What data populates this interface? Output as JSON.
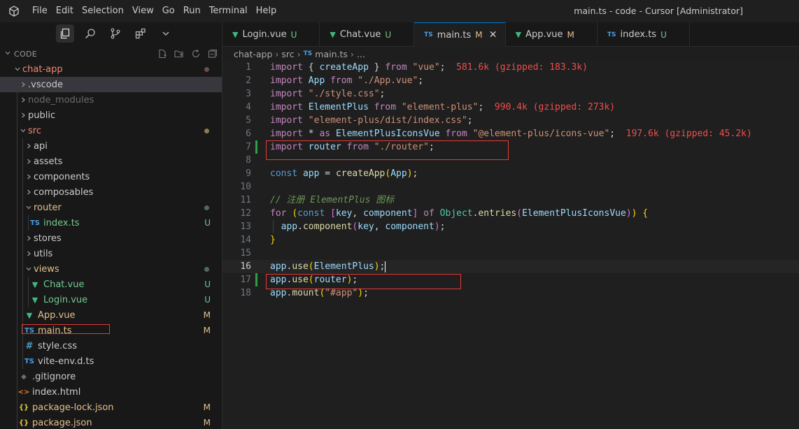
{
  "window": {
    "title": "main.ts - code - Cursor [Administrator]",
    "menu": [
      "File",
      "Edit",
      "Selection",
      "View",
      "Go",
      "Run",
      "Terminal",
      "Help"
    ]
  },
  "sidebar": {
    "explorer_title": "CODE",
    "tree": [
      {
        "label": "chat-app",
        "type": "folder",
        "open": true,
        "depth": 0,
        "color": "#f48771",
        "dot": "#6e4c4c"
      },
      {
        "label": ".vscode",
        "type": "folder",
        "open": false,
        "depth": 1,
        "selected": true
      },
      {
        "label": "node_modules",
        "type": "folder",
        "open": false,
        "depth": 1,
        "dim": true
      },
      {
        "label": "public",
        "type": "folder",
        "open": false,
        "depth": 1
      },
      {
        "label": "src",
        "type": "folder",
        "open": true,
        "depth": 1,
        "color": "#f48771",
        "dot": "#8b7b4e"
      },
      {
        "label": "api",
        "type": "folder",
        "open": false,
        "depth": 2
      },
      {
        "label": "assets",
        "type": "folder",
        "open": false,
        "depth": 2
      },
      {
        "label": "components",
        "type": "folder",
        "open": false,
        "depth": 2
      },
      {
        "label": "composables",
        "type": "folder",
        "open": false,
        "depth": 2
      },
      {
        "label": "router",
        "type": "folder",
        "open": true,
        "depth": 2,
        "color": "#e2c08d",
        "dot": "#4e6b5a"
      },
      {
        "label": "index.ts",
        "type": "ts",
        "depth": 3,
        "status": "U",
        "color": "#73c991"
      },
      {
        "label": "stores",
        "type": "folder",
        "open": false,
        "depth": 2
      },
      {
        "label": "utils",
        "type": "folder",
        "open": false,
        "depth": 2
      },
      {
        "label": "views",
        "type": "folder",
        "open": true,
        "depth": 2,
        "color": "#e2c08d",
        "dot": "#4e6b5a"
      },
      {
        "label": "Chat.vue",
        "type": "vue",
        "depth": 3,
        "status": "U",
        "color": "#73c991"
      },
      {
        "label": "Login.vue",
        "type": "vue",
        "depth": 3,
        "status": "U",
        "color": "#73c991"
      },
      {
        "label": "App.vue",
        "type": "vue",
        "depth": 2,
        "status": "M",
        "color": "#e2c08d"
      },
      {
        "label": "main.ts",
        "type": "ts",
        "depth": 2,
        "status": "M",
        "color": "#e2c08d",
        "boxed": true,
        "active": true
      },
      {
        "label": "style.css",
        "type": "css",
        "depth": 2
      },
      {
        "label": "vite-env.d.ts",
        "type": "ts",
        "depth": 2
      },
      {
        "label": ".gitignore",
        "type": "git",
        "depth": 1
      },
      {
        "label": "index.html",
        "type": "html",
        "depth": 1
      },
      {
        "label": "package-lock.json",
        "type": "json",
        "depth": 1,
        "status": "M",
        "color": "#e2c08d"
      },
      {
        "label": "package.json",
        "type": "json",
        "depth": 1,
        "status": "M",
        "color": "#e2c08d"
      }
    ]
  },
  "tabs": [
    {
      "label": "Login.vue",
      "icon": "vue",
      "status": "U",
      "active": false
    },
    {
      "label": "Chat.vue",
      "icon": "vue",
      "status": "U",
      "active": false
    },
    {
      "label": "main.ts",
      "icon": "ts",
      "status": "M",
      "active": true
    },
    {
      "label": "App.vue",
      "icon": "vue",
      "status": "M",
      "active": false
    },
    {
      "label": "index.ts",
      "icon": "ts",
      "status": "U",
      "active": false
    }
  ],
  "breadcrumbs": [
    "chat-app",
    "src",
    "main.ts",
    "..."
  ],
  "editor": {
    "current_line": 16,
    "lines": [
      {
        "n": 1,
        "html": "<span class='kc'>import</span> <span class='p'>{ </span><span class='v'>createApp</span><span class='p'> } </span><span class='kc'>from</span> <span class='s'>\"vue\"</span><span class='p'>;</span>  <span class='size'>581.6k (gzipped: 183.3k)</span>"
      },
      {
        "n": 2,
        "html": "<span class='kc'>import</span> <span class='v'>App</span> <span class='kc'>from</span> <span class='s'>\"./App.vue\"</span><span class='p'>;</span>"
      },
      {
        "n": 3,
        "html": "<span class='kc'>import</span> <span class='s'>\"./style.css\"</span><span class='p'>;</span>"
      },
      {
        "n": 4,
        "html": "<span class='kc'>import</span> <span class='v'>ElementPlus</span> <span class='kc'>from</span> <span class='s'>\"element-plus\"</span><span class='p'>;</span>  <span class='size'>990.4k (gzipped: 273k)</span>"
      },
      {
        "n": 5,
        "html": "<span class='kc'>import</span> <span class='s'>\"element-plus/dist/index.css\"</span><span class='p'>;</span>"
      },
      {
        "n": 6,
        "html": "<span class='kc'>import</span> <span class='p'>* </span><span class='kc'>as</span> <span class='v'>ElementPlusIconsVue</span> <span class='kc'>from</span> <span class='s'>\"@element-plus/icons-vue\"</span><span class='p'>;</span>  <span class='size'>197.6k (gzipped: 45.2k)</span>",
        "mark": false
      },
      {
        "n": 7,
        "html": "<span class='kc'>import</span> <span class='v'>router</span> <span class='kc'>from</span> <span class='s'>\"./router\"</span><span class='p'>;</span>",
        "mark": true
      },
      {
        "n": 8,
        "html": ""
      },
      {
        "n": 9,
        "html": "<span class='k'>const</span> <span class='v'>app</span> <span class='p'>=</span> <span class='f'>createApp</span><span class='br1'>(</span><span class='v'>App</span><span class='br1'>)</span><span class='p'>;</span>"
      },
      {
        "n": 10,
        "html": ""
      },
      {
        "n": 11,
        "html": "<span class='cm'>// 注册 ElementPlus 图标</span>"
      },
      {
        "n": 12,
        "html": "<span class='kc'>for</span> <span class='br1'>(</span><span class='k'>const</span> <span class='br2'>[</span><span class='v'>key</span><span class='p'>, </span><span class='v'>component</span><span class='br2'>]</span> <span class='kc'>of</span> <span class='t'>Object</span><span class='p'>.</span><span class='f'>entries</span><span class='br2'>(</span><span class='v'>ElementPlusIconsVue</span><span class='br2'>)</span><span class='br1'>)</span> <span class='br1'>{</span>"
      },
      {
        "n": 13,
        "html": "  <span class='v'>app</span><span class='p'>.</span><span class='f'>component</span><span class='br2'>(</span><span class='v'>key</span><span class='p'>, </span><span class='v'>component</span><span class='br2'>)</span><span class='p'>;</span>",
        "guide": true
      },
      {
        "n": 14,
        "html": "<span class='br1'>}</span>"
      },
      {
        "n": 15,
        "html": ""
      },
      {
        "n": 16,
        "html": "<span class='v'>app</span><span class='p'>.</span><span class='f'>use</span><span class='br1'>(</span><span class='v'>ElementPlus</span><span class='br1'>)</span><span class='p'>;</span><span class='cursor'></span>"
      },
      {
        "n": 17,
        "html": "<span class='v'>app</span><span class='p'>.</span><span class='f'>use</span><span class='br1'>(</span><span class='v'>router</span><span class='br1'>)</span><span class='p'>;</span>",
        "mark": true
      },
      {
        "n": 18,
        "html": "<span class='v'>app</span><span class='p'>.</span><span class='f'>mount</span><span class='br1'>(</span><span class='s'>\"#app\"</span><span class='br1'>)</span><span class='p'>;</span>"
      }
    ]
  }
}
